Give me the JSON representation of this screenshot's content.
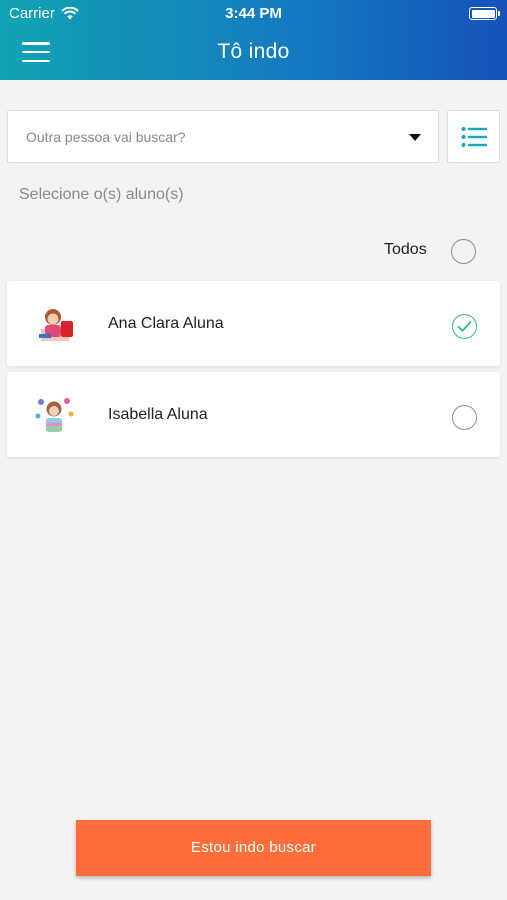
{
  "status_bar": {
    "carrier": "Carrier",
    "time": "3:44 PM",
    "wifi_icon": "wifi-icon",
    "battery_icon": "battery-icon"
  },
  "header": {
    "title": "Tô indo",
    "menu_icon": "hamburger-menu-icon",
    "gradient": [
      "#12a3b3",
      "#1553b8"
    ]
  },
  "picker": {
    "placeholder": "Outra pessoa vai buscar?",
    "caret_icon": "caret-down-icon",
    "list_icon": "list-icon"
  },
  "section_label": "Selecione o(s) aluno(s)",
  "select_all": {
    "label": "Todos",
    "checked": false
  },
  "students": [
    {
      "name": "Ana Clara Aluna",
      "checked": true
    },
    {
      "name": "Isabella Aluna",
      "checked": false
    }
  ],
  "action_button": {
    "label": "Estou indo buscar",
    "color": "#ff6d3b"
  },
  "colors": {
    "check_green": "#2ebd8e",
    "list_icon_teal": "#1aa7b8",
    "background": "#f4f3f4"
  }
}
